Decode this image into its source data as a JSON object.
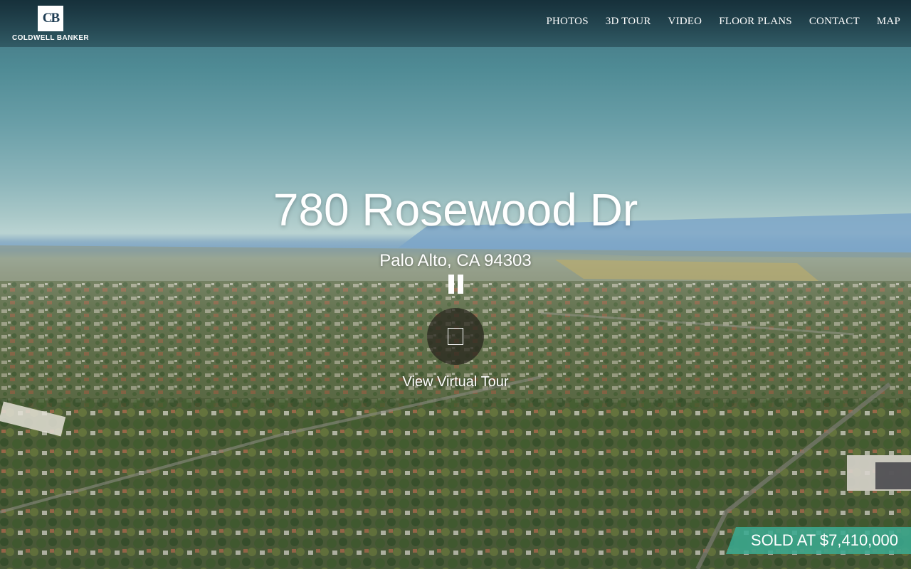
{
  "brand": {
    "logo_monogram": "CB",
    "name": "COLDWELL BANKER"
  },
  "nav": {
    "items": [
      {
        "label": "PHOTOS"
      },
      {
        "label": "3D TOUR"
      },
      {
        "label": "VIDEO"
      },
      {
        "label": "FLOOR PLANS"
      },
      {
        "label": "CONTACT"
      },
      {
        "label": "MAP"
      }
    ]
  },
  "hero": {
    "address": "780 Rosewood Dr",
    "city_line": "Palo Alto, CA 94303",
    "pause_icon": "pause-icon",
    "virtual_tour_icon": "square-icon",
    "virtual_tour_label": "View Virtual Tour",
    "sold_badge": "SOLD AT $7,410,000"
  },
  "colors": {
    "sold_badge": "#3aa890",
    "nav_text": "#ffffff",
    "topbar": "#1e3c46"
  }
}
